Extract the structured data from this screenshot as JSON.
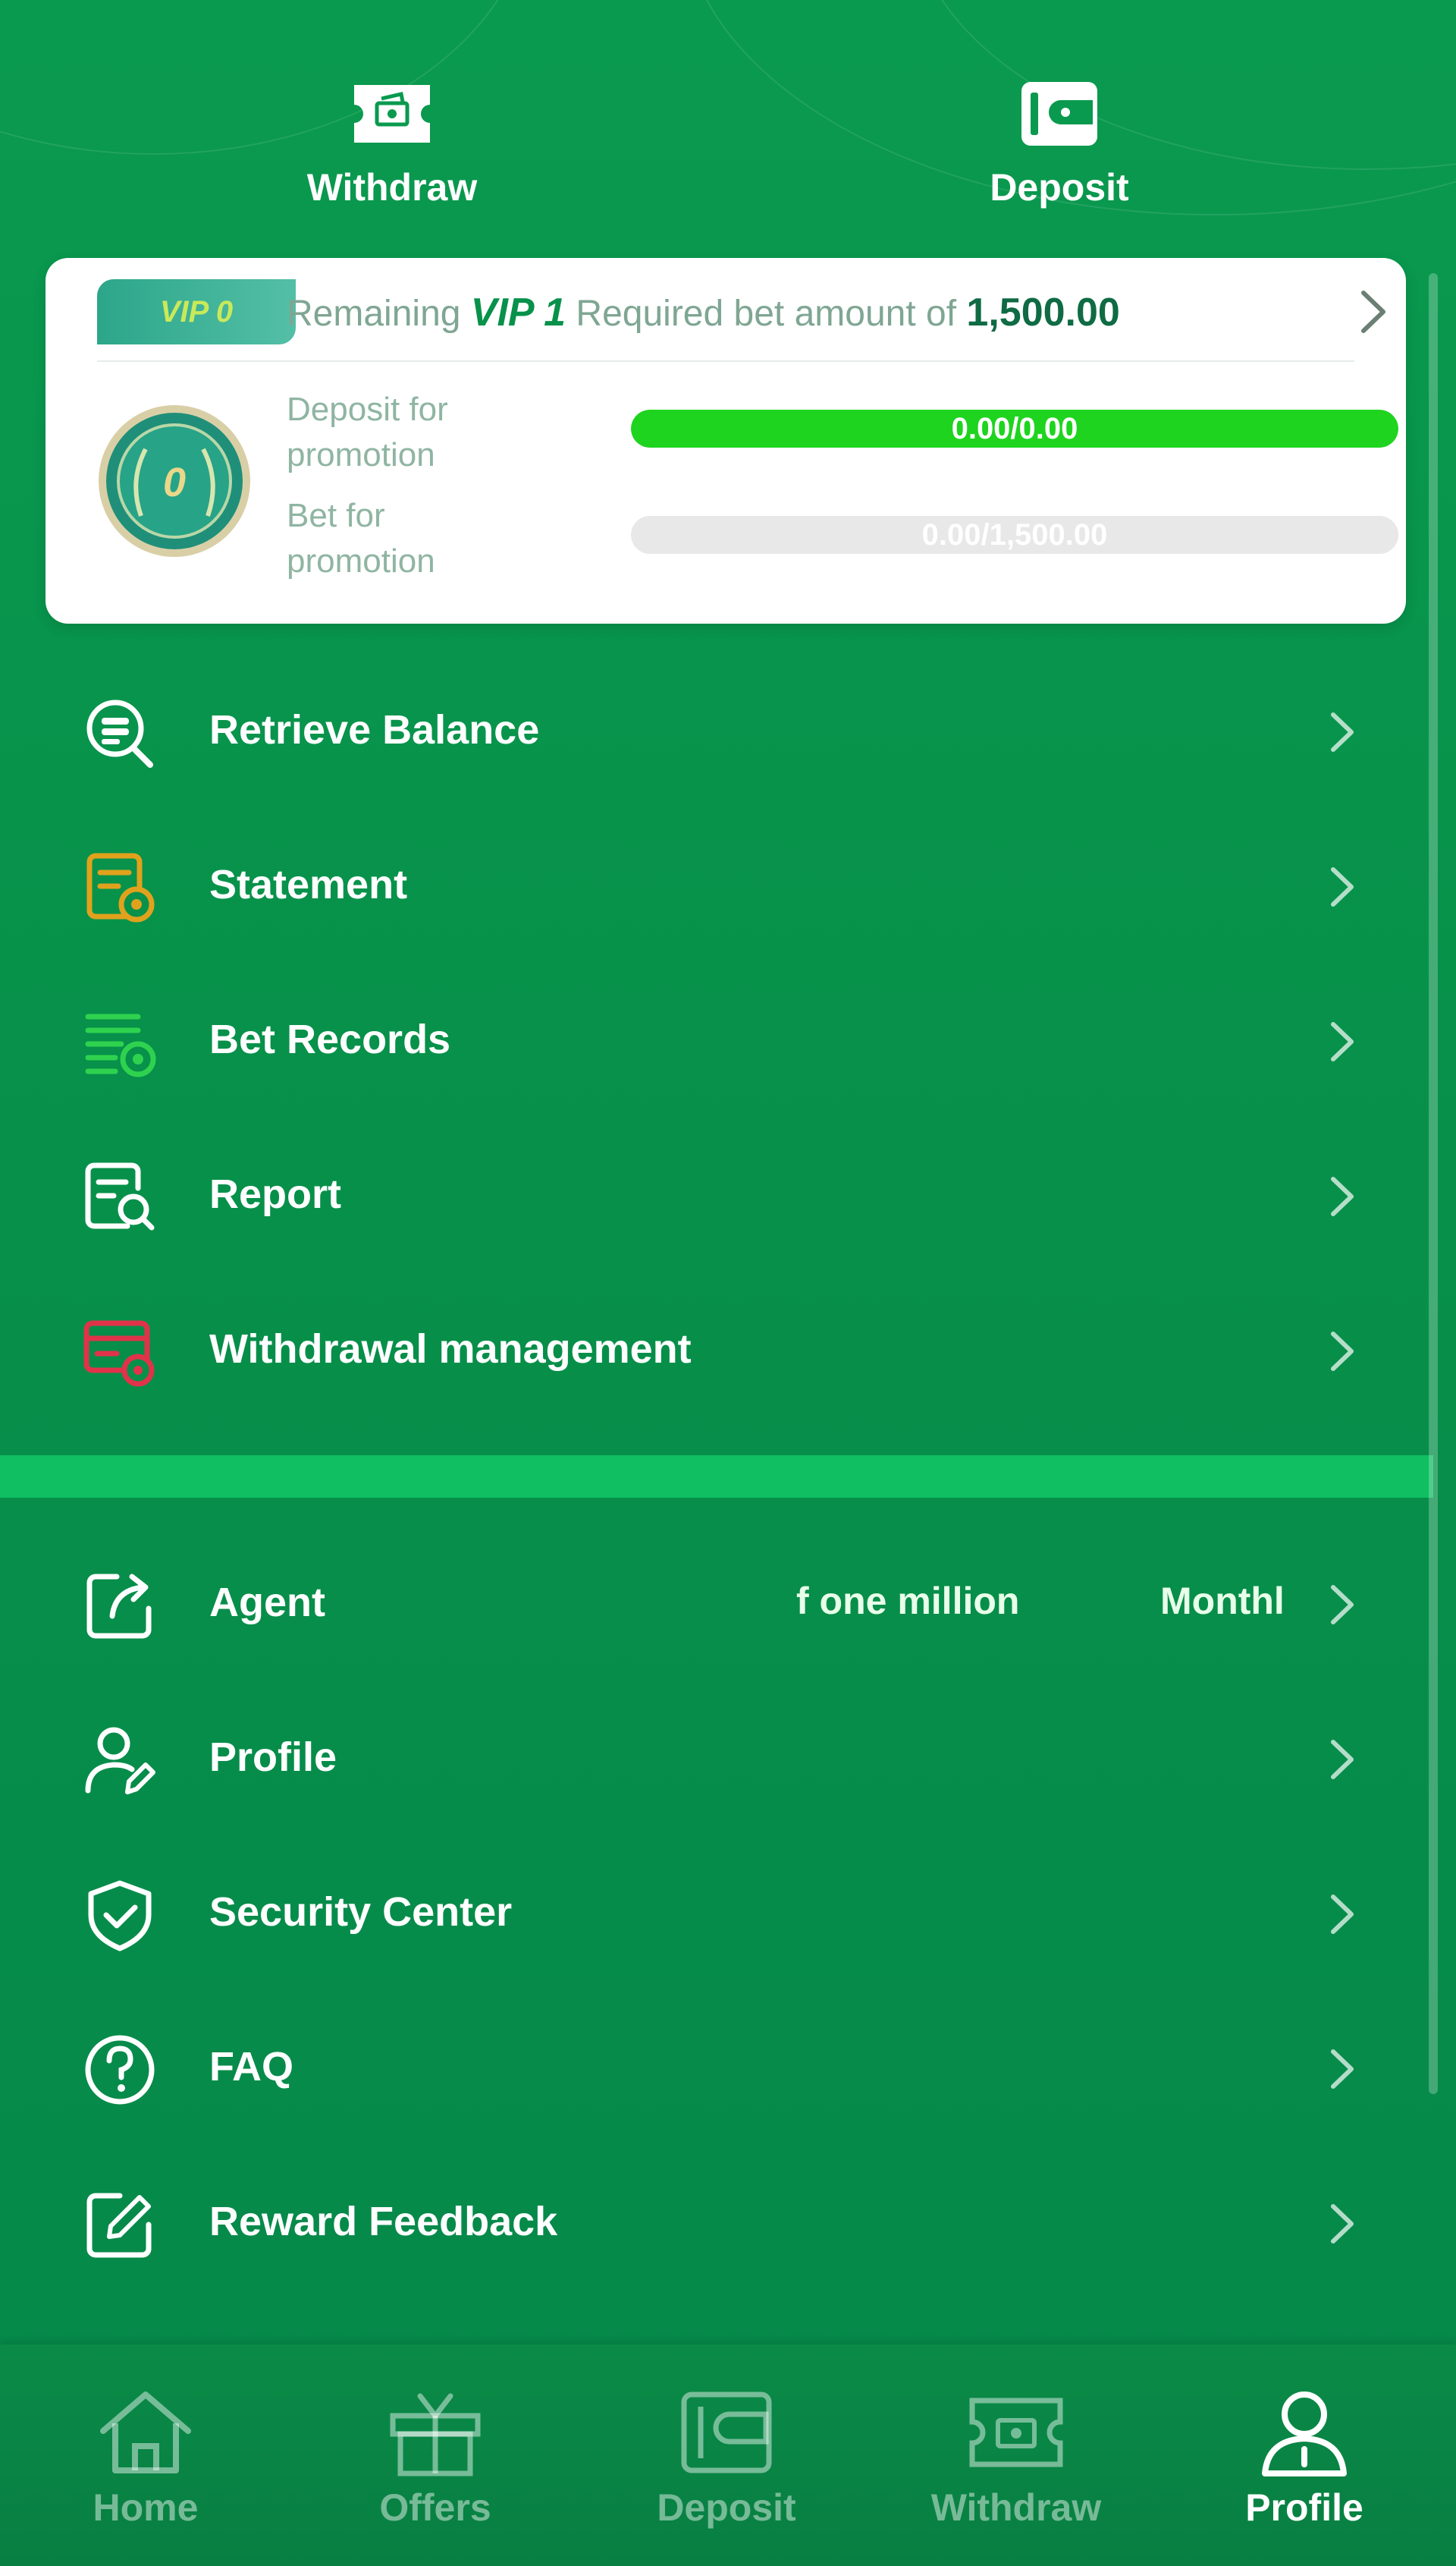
{
  "top_actions": [
    {
      "label": "Withdraw",
      "icon": "withdraw-ticket-icon"
    },
    {
      "label": "Deposit",
      "icon": "wallet-icon"
    }
  ],
  "vip": {
    "badge": "VIP 0",
    "remaining_prefix": "Remaining",
    "next_level": "VIP 1",
    "required_text": "Required bet amount of",
    "required_amount": "1,500.00",
    "deposit_label": "Deposit for promotion",
    "deposit_progress_text": "0.00/0.00",
    "deposit_progress_fraction": 1.0,
    "bet_label": "Bet for promotion",
    "bet_progress_text": "0.00/1,500.00",
    "bet_progress_fraction": 0.0,
    "medal_text": "0"
  },
  "menu_group_1": [
    {
      "label": "Retrieve Balance",
      "icon": "retrieve-balance-icon"
    },
    {
      "label": "Statement",
      "icon": "statement-icon"
    },
    {
      "label": "Bet Records",
      "icon": "bet-records-icon"
    },
    {
      "label": "Report",
      "icon": "report-icon"
    },
    {
      "label": "Withdrawal management",
      "icon": "withdrawal-management-icon"
    }
  ],
  "menu_group_2": [
    {
      "label": "Agent",
      "icon": "share-icon"
    },
    {
      "label": "Profile",
      "icon": "profile-edit-icon"
    },
    {
      "label": "Security Center",
      "icon": "shield-check-icon"
    },
    {
      "label": "FAQ",
      "icon": "question-icon"
    },
    {
      "label": "Reward Feedback",
      "icon": "feedback-edit-icon"
    }
  ],
  "agent_marquee": {
    "part1": "f one million",
    "part2": "Monthl"
  },
  "bottom_nav": [
    {
      "label": "Home",
      "icon": "home-icon",
      "active": false
    },
    {
      "label": "Offers",
      "icon": "gift-icon",
      "active": false
    },
    {
      "label": "Deposit",
      "icon": "wallet-icon",
      "active": false
    },
    {
      "label": "Withdraw",
      "icon": "withdraw-ticket-icon",
      "active": false
    },
    {
      "label": "Profile",
      "icon": "user-icon",
      "active": true
    }
  ],
  "colors": {
    "background": "#07914a",
    "progress_fill": "#1ed41e",
    "divider": "#0fbf61",
    "vip_text": "#7fa693"
  }
}
